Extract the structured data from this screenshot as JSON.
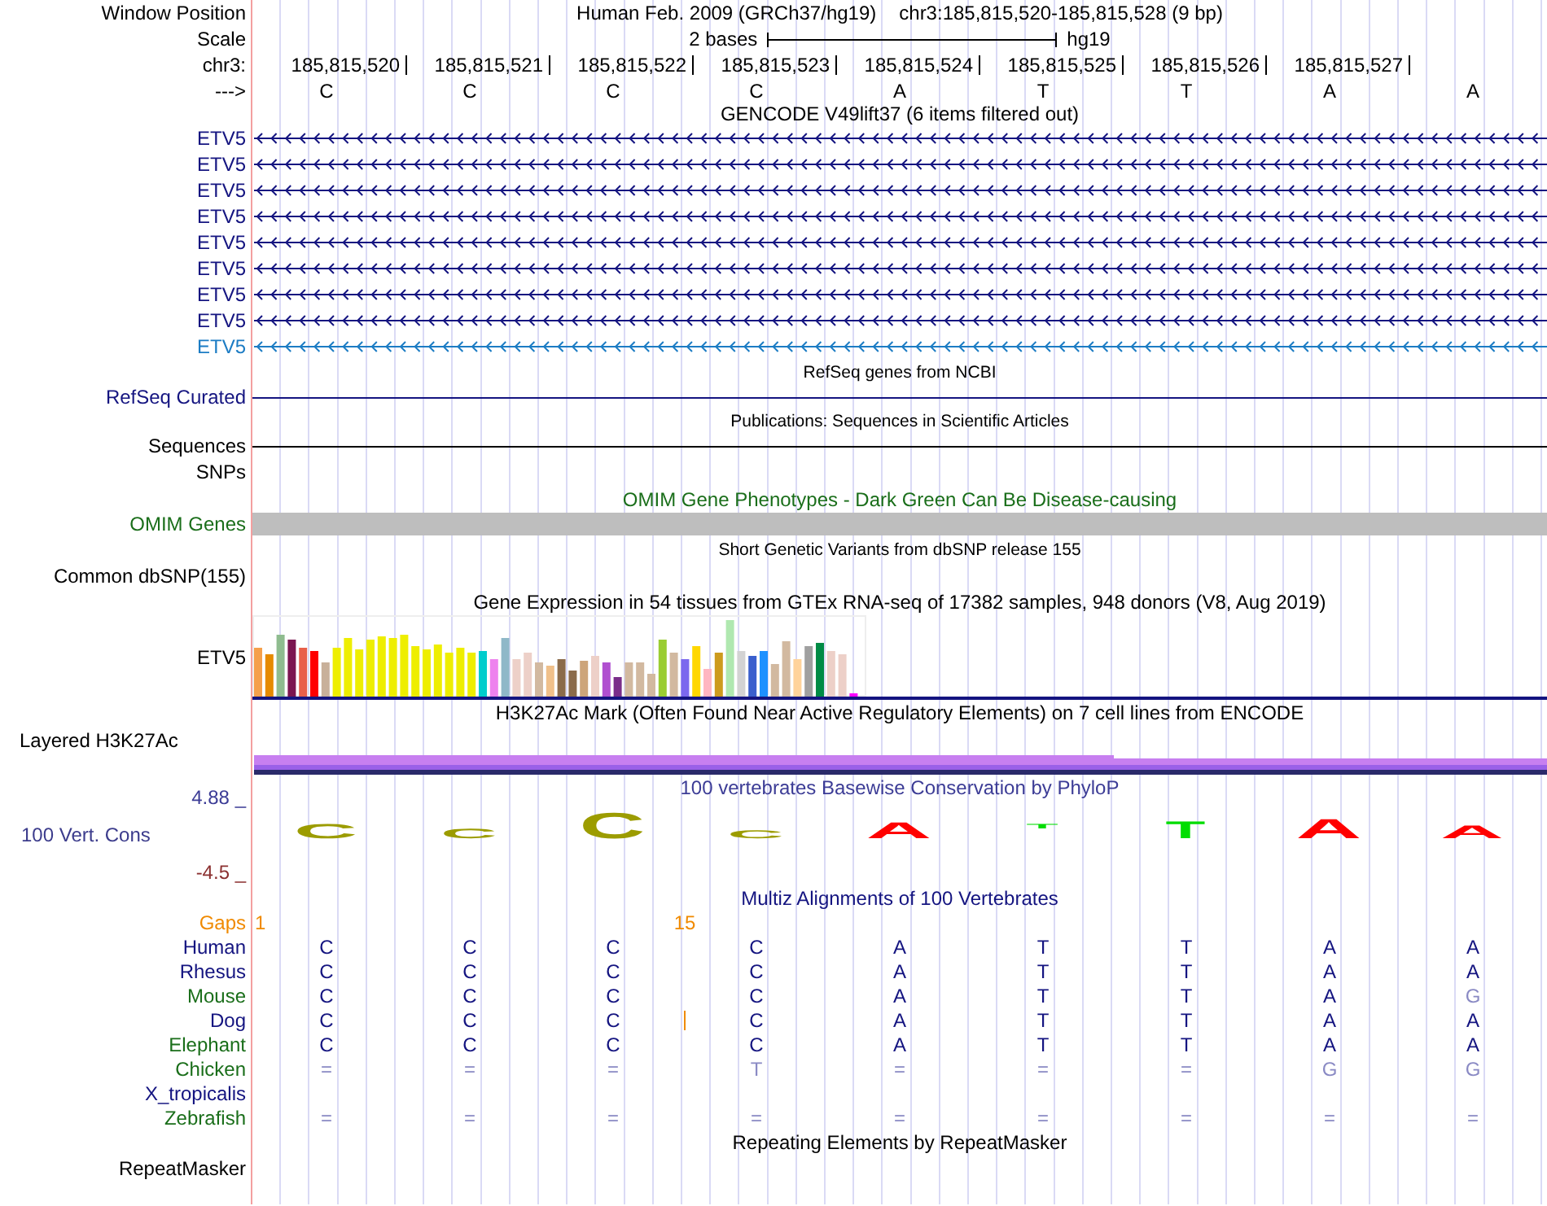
{
  "header": {
    "label": "Window Position",
    "assembly": "Human Feb. 2009 (GRCh37/hg19)",
    "position": "chr3:185,815,520-185,815,528 (9 bp)"
  },
  "scale": {
    "label": "Scale",
    "span": "2 bases",
    "assembly": "hg19"
  },
  "ruler": {
    "label": "chr3:",
    "positions": [
      "185,815,520",
      "185,815,521",
      "185,815,522",
      "185,815,523",
      "185,815,524",
      "185,815,525",
      "185,815,526",
      "185,815,527"
    ]
  },
  "sequence": {
    "label": "--->",
    "bases": [
      "C",
      "C",
      "C",
      "C",
      "A",
      "T",
      "T",
      "A",
      "A"
    ]
  },
  "gencode": {
    "title": "GENCODE V49lift37 (6 items filtered out)",
    "transcripts": [
      {
        "name": "ETV5",
        "color": "#141480"
      },
      {
        "name": "ETV5",
        "color": "#141480"
      },
      {
        "name": "ETV5",
        "color": "#141480"
      },
      {
        "name": "ETV5",
        "color": "#141480"
      },
      {
        "name": "ETV5",
        "color": "#141480"
      },
      {
        "name": "ETV5",
        "color": "#141480"
      },
      {
        "name": "ETV5",
        "color": "#141480"
      },
      {
        "name": "ETV5",
        "color": "#141480"
      },
      {
        "name": "ETV5",
        "color": "#1c7cc4"
      }
    ]
  },
  "refseq": {
    "title": "RefSeq genes from NCBI",
    "label": "RefSeq Curated"
  },
  "publications": {
    "title": "Publications: Sequences in Scientific Articles",
    "label": "Sequences"
  },
  "snps": {
    "label": "SNPs"
  },
  "omim": {
    "title": "OMIM Gene Phenotypes - Dark Green Can Be Disease-causing",
    "label": "OMIM Genes"
  },
  "dbsnp": {
    "title": "Short Genetic Variants from dbSNP release 155",
    "label": "Common dbSNP(155)"
  },
  "gtex": {
    "title": "Gene Expression in 54 tissues from GTEx RNA-seq of 17382 samples, 948 donors (V8, Aug 2019)",
    "label": "ETV5"
  },
  "h3k27ac": {
    "title": "H3K27Ac Mark (Often Found Near Active Regulatory Elements) on 7 cell lines from ENCODE",
    "label": "Layered H3K27Ac"
  },
  "phylop": {
    "title": "100 vertebrates Basewise Conservation by PhyloP",
    "label": "100 Vert. Cons",
    "max": "4.88 _",
    "min": "-4.5 _",
    "logo": [
      {
        "base": "C",
        "color": "#9c9c00"
      },
      {
        "base": "C",
        "color": "#9c9c00"
      },
      {
        "base": "C",
        "color": "#9c9c00"
      },
      {
        "base": "C",
        "color": "#9c9c00"
      },
      {
        "base": "A",
        "color": "#ff0000"
      },
      {
        "base": "T",
        "color": "#00dd00"
      },
      {
        "base": "T",
        "color": "#00dd00"
      },
      {
        "base": "A",
        "color": "#ff0000"
      },
      {
        "base": "A",
        "color": "#ff0000"
      }
    ]
  },
  "multiz": {
    "title": "Multiz Alignments of 100 Vertebrates",
    "gaps_label": "Gaps",
    "gap_counts": [
      "1",
      "15"
    ],
    "species": [
      {
        "name": "Human",
        "color": "#141480",
        "insertion": false,
        "bases": [
          "C",
          "C",
          "C",
          "C",
          "A",
          "T",
          "T",
          "A",
          "A"
        ],
        "faded": [
          false,
          false,
          false,
          false,
          false,
          false,
          false,
          false,
          false
        ]
      },
      {
        "name": "Rhesus",
        "color": "#141480",
        "insertion": false,
        "bases": [
          "C",
          "C",
          "C",
          "C",
          "A",
          "T",
          "T",
          "A",
          "A"
        ],
        "faded": [
          false,
          false,
          false,
          false,
          false,
          false,
          false,
          false,
          false
        ]
      },
      {
        "name": "Mouse",
        "color": "#1a6e1a",
        "insertion": false,
        "bases": [
          "C",
          "C",
          "C",
          "C",
          "A",
          "T",
          "T",
          "A",
          "G"
        ],
        "faded": [
          false,
          false,
          false,
          false,
          false,
          false,
          false,
          false,
          true
        ]
      },
      {
        "name": "Dog",
        "color": "#141480",
        "insertion": true,
        "bases": [
          "C",
          "C",
          "C",
          "C",
          "A",
          "T",
          "T",
          "A",
          "A"
        ],
        "faded": [
          false,
          false,
          false,
          false,
          false,
          false,
          false,
          false,
          false
        ]
      },
      {
        "name": "Elephant",
        "color": "#1a6e1a",
        "insertion": false,
        "bases": [
          "C",
          "C",
          "C",
          "C",
          "A",
          "T",
          "T",
          "A",
          "A"
        ],
        "faded": [
          false,
          false,
          false,
          false,
          false,
          false,
          false,
          false,
          false
        ]
      },
      {
        "name": "Chicken",
        "color": "#1a6e1a",
        "insertion": false,
        "bases": [
          "=",
          "=",
          "=",
          "T",
          "=",
          "=",
          "=",
          "G",
          "G"
        ],
        "faded": [
          true,
          true,
          true,
          true,
          true,
          true,
          true,
          true,
          true
        ]
      },
      {
        "name": "X_tropicalis",
        "color": "#141480",
        "insertion": false
      },
      {
        "name": "Zebrafish",
        "color": "#1a6e1a",
        "insertion": false,
        "bases": [
          "=",
          "=",
          "=",
          "=",
          "=",
          "=",
          "=",
          "=",
          "="
        ],
        "faded": [
          true,
          true,
          true,
          true,
          true,
          true,
          true,
          true,
          true
        ]
      }
    ]
  },
  "repeatmasker": {
    "title": "Repeating Elements by RepeatMasker",
    "label": "RepeatMasker"
  }
}
